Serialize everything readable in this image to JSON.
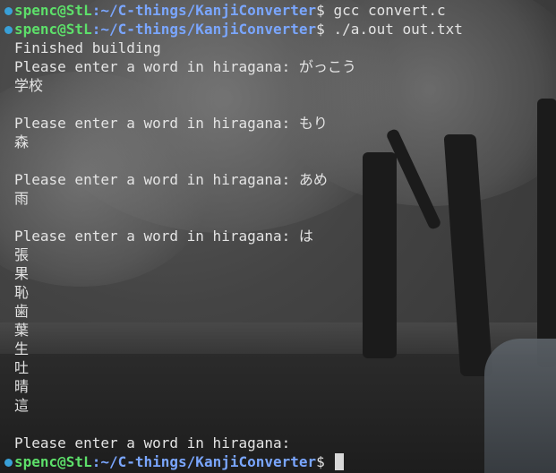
{
  "terminal": {
    "prompt": {
      "user_host": "spenc@StL",
      "separator": ":",
      "path": "~/C-things/KanjiConverter",
      "symbol": "$"
    },
    "lines": [
      {
        "kind": "prompt",
        "command": " gcc convert.c"
      },
      {
        "kind": "prompt",
        "command": " ./a.out out.txt"
      },
      {
        "kind": "output",
        "text": "Finished building"
      },
      {
        "kind": "output",
        "text": "Please enter a word in hiragana: がっこう"
      },
      {
        "kind": "output",
        "text": "学校"
      },
      {
        "kind": "output",
        "text": ""
      },
      {
        "kind": "output",
        "text": "Please enter a word in hiragana: もり"
      },
      {
        "kind": "output",
        "text": "森"
      },
      {
        "kind": "output",
        "text": ""
      },
      {
        "kind": "output",
        "text": "Please enter a word in hiragana: あめ"
      },
      {
        "kind": "output",
        "text": "雨"
      },
      {
        "kind": "output",
        "text": ""
      },
      {
        "kind": "output",
        "text": "Please enter a word in hiragana: は"
      },
      {
        "kind": "output",
        "text": "張"
      },
      {
        "kind": "output",
        "text": "果"
      },
      {
        "kind": "output",
        "text": "恥"
      },
      {
        "kind": "output",
        "text": "歯"
      },
      {
        "kind": "output",
        "text": "葉"
      },
      {
        "kind": "output",
        "text": "生"
      },
      {
        "kind": "output",
        "text": "吐"
      },
      {
        "kind": "output",
        "text": "晴"
      },
      {
        "kind": "output",
        "text": "這"
      },
      {
        "kind": "output",
        "text": ""
      },
      {
        "kind": "output",
        "text": "Please enter a word in hiragana: "
      },
      {
        "kind": "prompt",
        "command": " ",
        "cursor": true
      }
    ]
  },
  "colors": {
    "user_host": "#5ddf6a",
    "path": "#7aa6ff",
    "text": "#e4e4e4",
    "prompt_marker": "#39a0d8"
  },
  "icons": {
    "prompt_marker": "prompt-marker-icon",
    "cursor": "block-cursor"
  }
}
